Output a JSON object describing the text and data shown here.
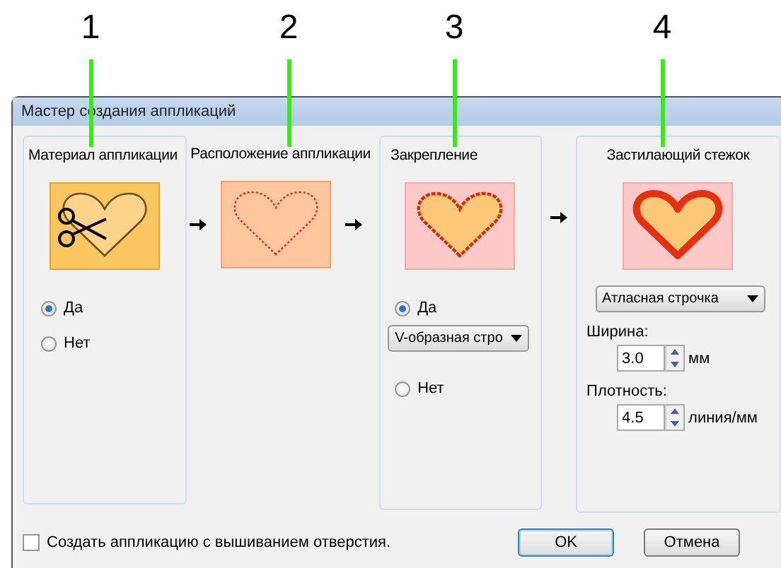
{
  "callouts": [
    "1",
    "2",
    "3",
    "4"
  ],
  "dialog": {
    "title": "Мастер создания аппликаций"
  },
  "panels": [
    {
      "kind": "material",
      "title": "Материал аппликации",
      "radios": [
        {
          "label": "Да",
          "selected": true
        },
        {
          "label": "Нет",
          "selected": false
        }
      ]
    },
    {
      "kind": "placement",
      "title": "Расположение аппликации"
    },
    {
      "kind": "tacking",
      "title": "Закрепление",
      "radios": [
        {
          "label": "Да",
          "selected": true
        },
        {
          "label": "Нет",
          "selected": false
        }
      ],
      "dropdown": "V-образная стро"
    },
    {
      "kind": "cover",
      "title": "Застилающий стежок",
      "dropdown": "Атласная строчка",
      "fields": [
        {
          "label": "Ширина:",
          "value": "3.0",
          "unit": "мм"
        },
        {
          "label": "Плотность:",
          "value": "4.5",
          "unit": "линия/мм"
        }
      ]
    }
  ],
  "hole_option": {
    "label": "Создать аппликацию с вышиванием отверстия.",
    "checked": false
  },
  "buttons": [
    {
      "label": "OK",
      "default": true
    },
    {
      "label": "Отмена",
      "default": false
    }
  ]
}
